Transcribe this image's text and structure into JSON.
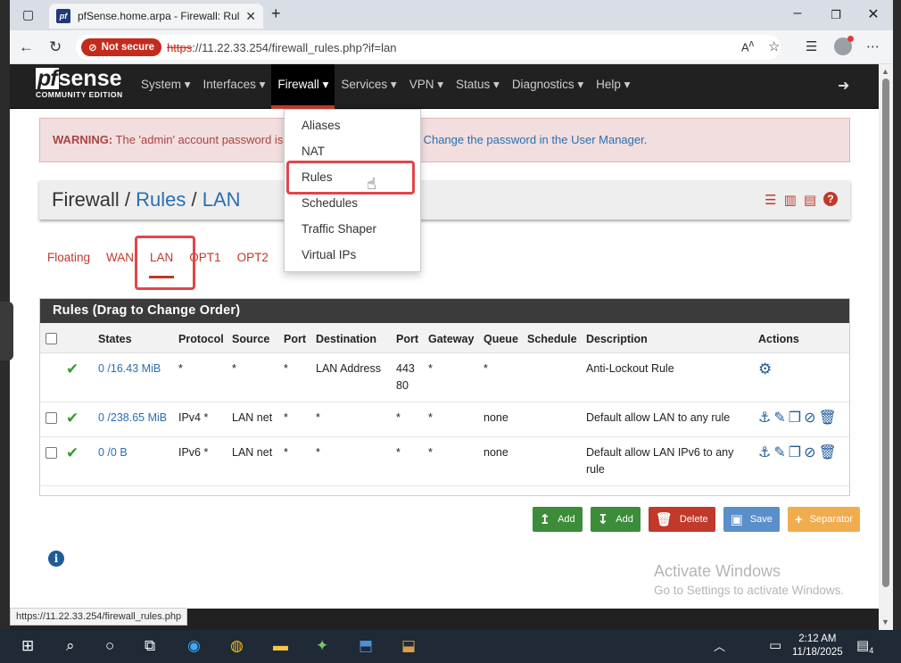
{
  "browser": {
    "tab_title": "pfSense.home.arpa - Firewall: Rul",
    "tab_favicon": "pf",
    "not_secure_label": "Not secure",
    "url_scheme": "https",
    "url_rest": "://11.22.33.254/firewall_rules.php?if=lan",
    "status_url": "https://11.22.33.254/firewall_rules.php"
  },
  "nav": {
    "logo_pf": "pf",
    "logo_sense": "sense",
    "logo_edition": "COMMUNITY EDITION",
    "menu": [
      {
        "label": "System ▾"
      },
      {
        "label": "Interfaces ▾"
      },
      {
        "label": "Firewall ▾"
      },
      {
        "label": "Services ▾"
      },
      {
        "label": "VPN ▾"
      },
      {
        "label": "Status ▾"
      },
      {
        "label": "Diagnostics ▾"
      },
      {
        "label": "Help ▾"
      }
    ]
  },
  "firewall_menu": [
    "Aliases",
    "NAT",
    "Rules",
    "Schedules",
    "Traffic Shaper",
    "Virtual IPs"
  ],
  "warning": {
    "bold": "WARNING:",
    "text": " The 'admin' account password is",
    "link": "Change the password in the User Manager."
  },
  "breadcrumb": {
    "part1": "Firewall",
    "part2": "Rules",
    "part3": "LAN",
    "sep": " / "
  },
  "interface_tabs": [
    "Floating",
    "WAN",
    "LAN",
    "OPT1",
    "OPT2"
  ],
  "rules_panel": {
    "title": "Rules (Drag to Change Order)",
    "columns": [
      "States",
      "Protocol",
      "Source",
      "Port",
      "Destination",
      "Port",
      "Gateway",
      "Queue",
      "Schedule",
      "Description",
      "Actions"
    ],
    "rows": [
      {
        "states": "0 /16.43 MiB",
        "protocol": "*",
        "source": "*",
        "sport": "*",
        "destination": "LAN Address",
        "dport": "443 80",
        "gateway": "*",
        "queue": "*",
        "schedule": "",
        "description": "Anti-Lockout Rule"
      },
      {
        "states": "0 /238.65 MiB",
        "protocol": "IPv4 *",
        "source": "LAN net",
        "sport": "*",
        "destination": "*",
        "dport": "*",
        "gateway": "*",
        "queue": "none",
        "schedule": "",
        "description": "Default allow LAN to any rule"
      },
      {
        "states": "0 /0 B",
        "protocol": "IPv6 *",
        "source": "LAN net",
        "sport": "*",
        "destination": "*",
        "dport": "*",
        "gateway": "*",
        "queue": "none",
        "schedule": "",
        "description": "Default allow LAN IPv6 to any rule"
      }
    ]
  },
  "buttons": {
    "add_top": "Add",
    "add_bottom": "Add",
    "delete": "Delete",
    "save": "Save",
    "separator": "Separator"
  },
  "watermark": {
    "line1": "Activate Windows",
    "line2": "Go to Settings to activate Windows."
  },
  "taskbar": {
    "time": "2:12 AM",
    "date": "11/18/2025",
    "notif_count": "4"
  },
  "colors": {
    "brand_red": "#c0392b",
    "link_blue": "#2a6fb0",
    "nav_dark": "#212121"
  }
}
